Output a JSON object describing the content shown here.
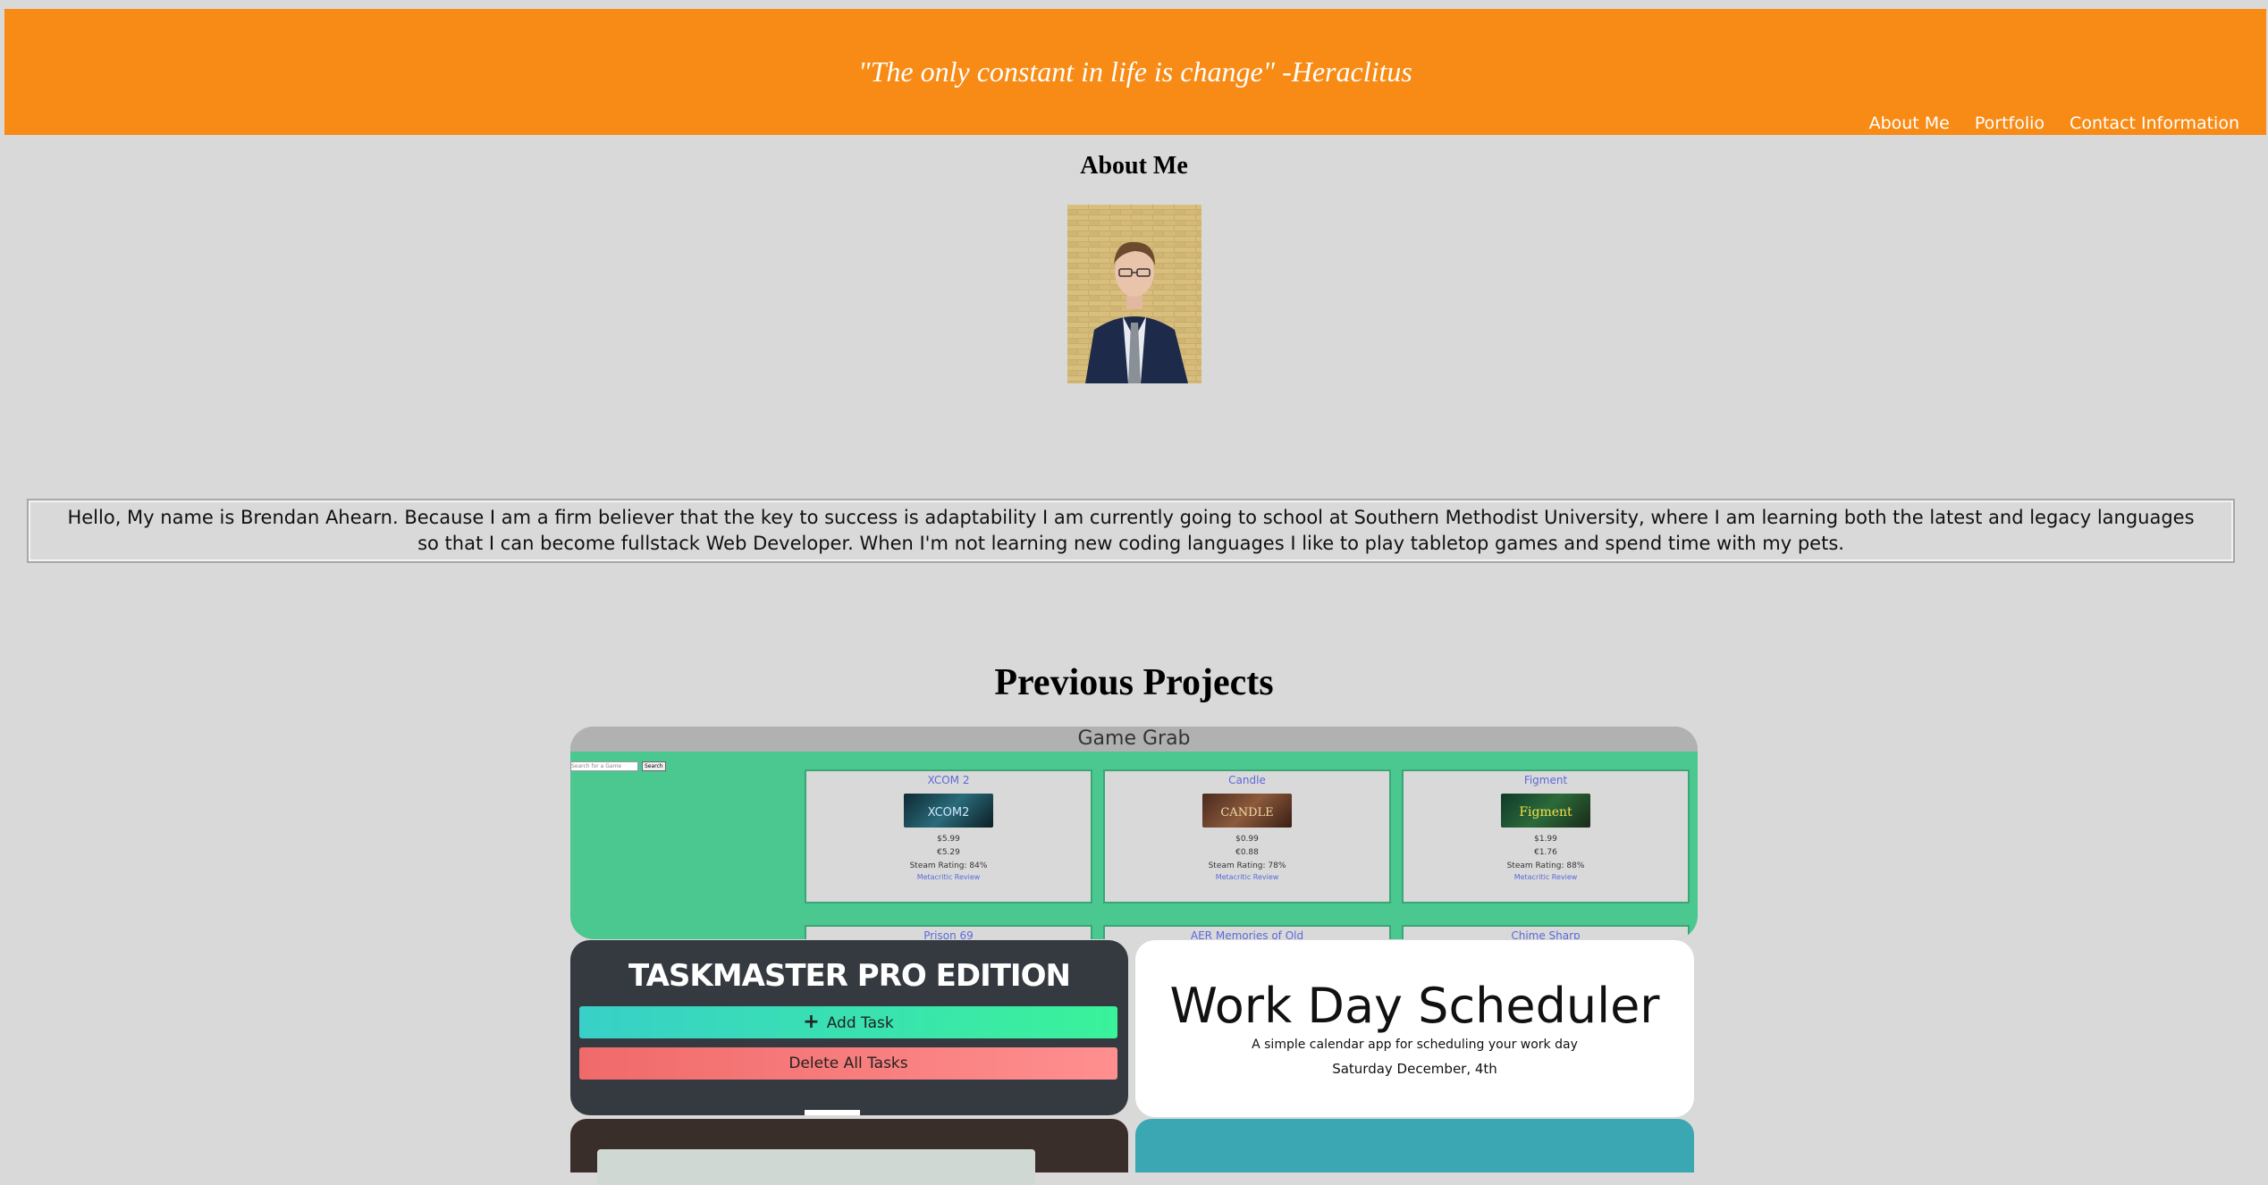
{
  "header": {
    "quote": "\"The only constant in life is change\" -Heraclitus",
    "nav": [
      "About Me",
      "Portfolio",
      "Contact Information"
    ],
    "background": "#f78b15"
  },
  "about": {
    "title": "About Me",
    "bio": "Hello, My name is Brendan Ahearn. Because I am a firm believer that the key to success is adaptability I am currently going to school at Southern Methodist University, where I am learning both the latest and legacy languages so that I can become fullstack Web Developer. When I'm not learning new coding languages I like to play tabletop games and spend time with my pets."
  },
  "projects": {
    "title": "Previous Projects",
    "game_grab": {
      "title": "Game Grab",
      "search_placeholder": "Search for a Game",
      "search_button": "Search",
      "games": [
        {
          "name": "XCOM 2",
          "price_usd": "$5.99",
          "price_eur": "€5.29",
          "rating": "Steam Rating: 84%",
          "meta": "Metacritic Review"
        },
        {
          "name": "Candle",
          "price_usd": "$0.99",
          "price_eur": "€0.88",
          "rating": "Steam Rating: 78%",
          "meta": "Metacritic Review"
        },
        {
          "name": "Figment",
          "price_usd": "$1.99",
          "price_eur": "€1.76",
          "rating": "Steam Rating: 88%",
          "meta": "Metacritic Review"
        }
      ],
      "games_row2": [
        "Prison 69",
        "AER Memories of Old",
        "Chime Sharp"
      ]
    },
    "taskmaster": {
      "title": "TASKMASTER PRO EDITION",
      "add_label": "Add Task",
      "delete_label": "Delete All Tasks"
    },
    "scheduler": {
      "title": "Work Day Scheduler",
      "subtitle": "A simple calendar app for scheduling your work day",
      "date": "Saturday December, 4th"
    }
  }
}
